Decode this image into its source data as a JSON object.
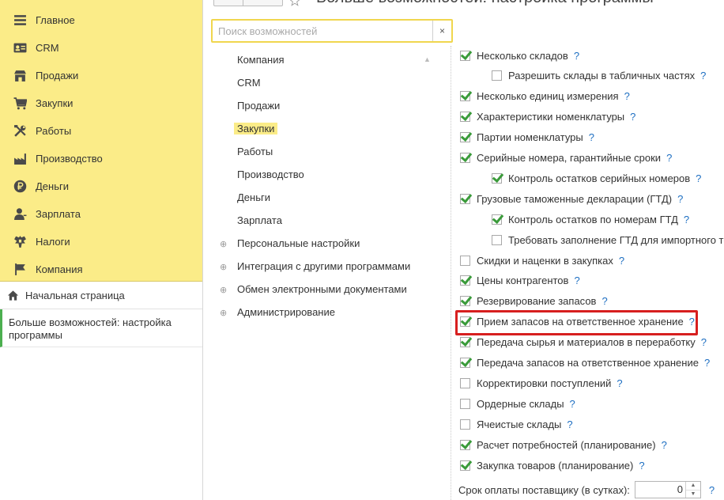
{
  "header": {
    "title": "Больше возможностей: настройка программы"
  },
  "sidebar": {
    "menu": [
      {
        "label": "Главное",
        "icon": "menu-lines-icon"
      },
      {
        "label": "CRM",
        "icon": "contact-card-icon"
      },
      {
        "label": "Продажи",
        "icon": "shop-icon"
      },
      {
        "label": "Закупки",
        "icon": "cart-icon"
      },
      {
        "label": "Работы",
        "icon": "tools-icon"
      },
      {
        "label": "Производство",
        "icon": "factory-icon"
      },
      {
        "label": "Деньги",
        "icon": "ruble-coin-icon"
      },
      {
        "label": "Зарплата",
        "icon": "person-icon"
      },
      {
        "label": "Налоги",
        "icon": "eagle-emblem-icon"
      },
      {
        "label": "Компания",
        "icon": "flag-icon"
      }
    ],
    "home_label": "Начальная страница",
    "open_window": "Больше возможностей: настройка программы"
  },
  "search": {
    "placeholder": "Поиск возможностей",
    "value": "",
    "clear_label": "×"
  },
  "sections": [
    {
      "label": "Компания",
      "expandable": false,
      "selected": false
    },
    {
      "label": "CRM",
      "expandable": false,
      "selected": false
    },
    {
      "label": "Продажи",
      "expandable": false,
      "selected": false
    },
    {
      "label": "Закупки",
      "expandable": false,
      "selected": true
    },
    {
      "label": "Работы",
      "expandable": false,
      "selected": false
    },
    {
      "label": "Производство",
      "expandable": false,
      "selected": false
    },
    {
      "label": "Деньги",
      "expandable": false,
      "selected": false
    },
    {
      "label": "Зарплата",
      "expandable": false,
      "selected": false
    },
    {
      "label": "Персональные настройки",
      "expandable": true,
      "selected": false
    },
    {
      "label": "Интеграция с другими программами",
      "expandable": true,
      "selected": false
    },
    {
      "label": "Обмен электронными документами",
      "expandable": true,
      "selected": false
    },
    {
      "label": "Администрирование",
      "expandable": true,
      "selected": false
    }
  ],
  "options": [
    {
      "label": "Несколько складов",
      "checked": true,
      "level": 0
    },
    {
      "label": "Разрешить склады в табличных частях",
      "checked": false,
      "level": 2
    },
    {
      "label": "Несколько единиц измерения",
      "checked": true,
      "level": 0
    },
    {
      "label": "Характеристики номенклатуры",
      "checked": true,
      "level": 0
    },
    {
      "label": "Партии номенклатуры",
      "checked": true,
      "level": 0
    },
    {
      "label": "Серийные номера, гарантийные сроки",
      "checked": true,
      "level": 0
    },
    {
      "label": "Контроль остатков серийных номеров",
      "checked": true,
      "level": 2
    },
    {
      "label": "Грузовые таможенные декларации (ГТД)",
      "checked": true,
      "level": 0
    },
    {
      "label": "Контроль остатков по номерам ГТД",
      "checked": true,
      "level": 2
    },
    {
      "label": "Требовать заполнение ГТД для импортного то",
      "checked": false,
      "level": 2,
      "no_help": true
    },
    {
      "label": "Скидки и наценки в закупках",
      "checked": false,
      "level": 0
    },
    {
      "label": "Цены контрагентов",
      "checked": true,
      "level": 0
    },
    {
      "label": "Резервирование запасов",
      "checked": true,
      "level": 0
    },
    {
      "label": "Прием запасов на ответственное хранение",
      "checked": true,
      "level": 0
    },
    {
      "label": "Передача сырья и материалов в переработку",
      "checked": true,
      "level": 0
    },
    {
      "label": "Передача запасов на ответственное хранение",
      "checked": true,
      "level": 0
    },
    {
      "label": "Корректировки поступлений",
      "checked": false,
      "level": 0
    },
    {
      "label": "Ордерные склады",
      "checked": false,
      "level": 0
    },
    {
      "label": "Ячеистые склады",
      "checked": false,
      "level": 0
    },
    {
      "label": "Расчет потребностей (планирование)",
      "checked": true,
      "level": 0
    },
    {
      "label": "Закупка товаров (планирование)",
      "checked": true,
      "level": 0
    }
  ],
  "help_mark": "?",
  "supplier_term": {
    "label": "Срок оплаты поставщику (в сутках):",
    "value": "0"
  },
  "colors": {
    "menu_bg": "#fbec88",
    "check": "#3a9b3a",
    "help": "#1e6fc2",
    "highlight": "#d71f1f"
  }
}
